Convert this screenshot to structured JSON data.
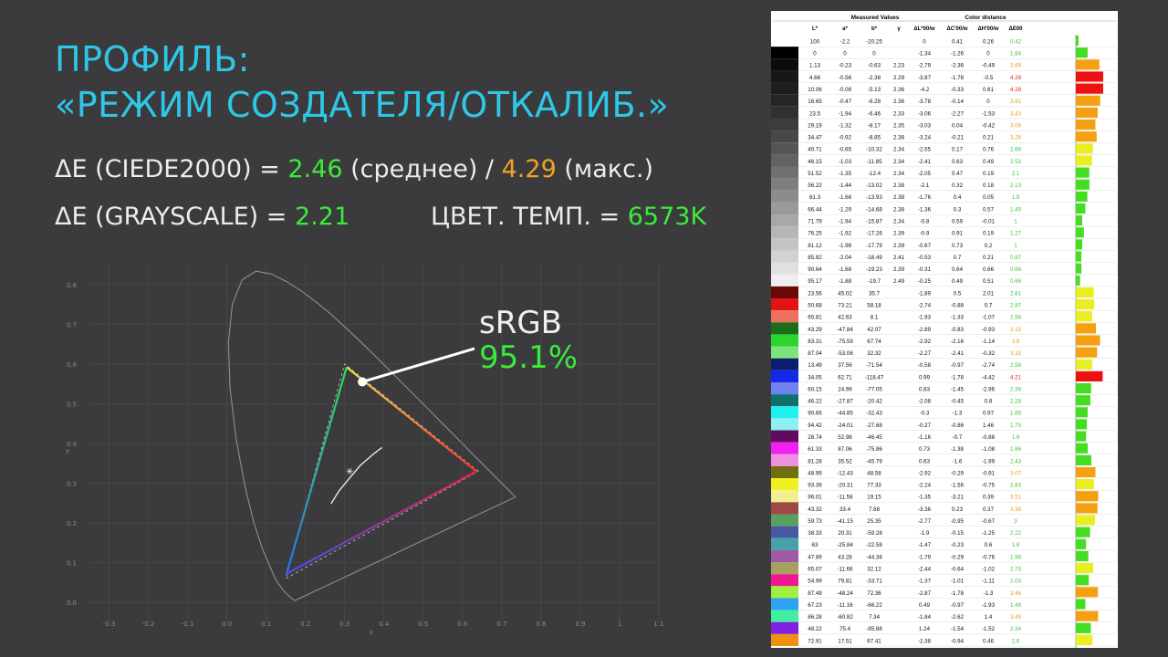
{
  "title": {
    "line1": "ПРОФИЛЬ:",
    "line2": "«РЕЖИМ СОЗДАТЕЛЯ/ОТКАЛИБ.»"
  },
  "stats": {
    "de_prefix": "ΔE (CIEDE2000) =",
    "de_avg": "2.46",
    "avg_label": "(среднее) /",
    "de_max": "4.29",
    "max_label": "(макс.)",
    "gray_prefix": "ΔE (GRAYSCALE) =",
    "gray_value": "2.21",
    "temp_prefix": "ЦВЕТ. ТЕМП. =",
    "temp_value": "6573K"
  },
  "srgb": {
    "name": "sRGB",
    "coverage": "95.1%"
  },
  "colors": {
    "accent_cyan": "#2ec7e8",
    "green": "#3bea3b",
    "orange": "#f2a324",
    "background": "#3b3b3d"
  },
  "chart_data": [
    {
      "type": "scatter",
      "title": "",
      "xlabel": "x",
      "ylabel": "y",
      "xlim": [
        -0.35,
        1.1
      ],
      "ylim": [
        -0.05,
        0.85
      ],
      "x_ticks": [
        "-0.3",
        "-0.2",
        "-0.1",
        "0.0",
        "0.1",
        "0.2",
        "0.3",
        "0.4",
        "0.5",
        "0.6",
        "0.7",
        "0.8",
        "0.9",
        "1",
        "1.1"
      ],
      "y_ticks": [
        "0.0",
        "0.1",
        "0.2",
        "0.3",
        "0.4",
        "0.5",
        "0.6",
        "0.7",
        "0.8"
      ],
      "grid": true,
      "primaries": {
        "red": [
          0.64,
          0.33
        ],
        "green": [
          0.3,
          0.6
        ],
        "blue": [
          0.15,
          0.06
        ],
        "white": [
          0.3127,
          0.329
        ]
      },
      "coverage_marker": [
        0.345,
        0.555
      ]
    },
    {
      "type": "table",
      "header_group_1": "Measured Values",
      "header_group_2": "Color distance",
      "columns": [
        "L*",
        "a*",
        "b*",
        "γ",
        "ΔL*00/w",
        "ΔC'00/w",
        "ΔH'00/w",
        "ΔE00"
      ],
      "rows": [
        {
          "swatch": "#ffffff",
          "v": [
            "100",
            "-2.2",
            "-20.25",
            "",
            "0",
            "0.41",
            "0.26",
            "0.42"
          ],
          "de": 0.42
        },
        {
          "swatch": "#000000",
          "v": [
            "0",
            "0",
            "0",
            "",
            "-1.34",
            "-1.26",
            "0",
            "1.84"
          ],
          "de": 1.84
        },
        {
          "swatch": "#0c0c0c",
          "v": [
            "1.13",
            "-0.23",
            "-0.63",
            "2.23",
            "-2.79",
            "-2.36",
            "-0.49",
            "3.69"
          ],
          "de": 3.69
        },
        {
          "swatch": "#171717",
          "v": [
            "4.66",
            "-0.56",
            "-2.38",
            "2.29",
            "-3.87",
            "-1.78",
            "-0.5",
            "4.29"
          ],
          "de": 4.29
        },
        {
          "swatch": "#1e1e1e",
          "v": [
            "10.06",
            "-0.08",
            "-5.13",
            "2.36",
            "-4.2",
            "-0.33",
            "0.61",
            "4.28"
          ],
          "de": 4.28
        },
        {
          "swatch": "#262626",
          "v": [
            "16.65",
            "-0.47",
            "-6.28",
            "2.36",
            "-3.78",
            "-0.14",
            "0",
            "3.81"
          ],
          "de": 3.81
        },
        {
          "swatch": "#303030",
          "v": [
            "23.5",
            "-1.94",
            "-6.46",
            "2.33",
            "-3.06",
            "-2.27",
            "-1.53",
            "3.43"
          ],
          "de": 3.43
        },
        {
          "swatch": "#3c3c3c",
          "v": [
            "29.19",
            "-1.32",
            "-8.17",
            "2.35",
            "-3.03",
            "0.04",
            "-0.42",
            "3.06"
          ],
          "de": 3.06
        },
        {
          "swatch": "#484848",
          "v": [
            "34.47",
            "-0.92",
            "-8.85",
            "2.38",
            "-3.24",
            "-0.21",
            "0.21",
            "3.26"
          ],
          "de": 3.26
        },
        {
          "swatch": "#555555",
          "v": [
            "40.71",
            "-0.65",
            "-10.32",
            "2.34",
            "-2.55",
            "0.17",
            "0.76",
            "2.66"
          ],
          "de": 2.66
        },
        {
          "swatch": "#626262",
          "v": [
            "46.15",
            "-1.03",
            "-11.85",
            "2.34",
            "-2.41",
            "0.63",
            "0.49",
            "2.53"
          ],
          "de": 2.53
        },
        {
          "swatch": "#707070",
          "v": [
            "51.52",
            "-1.35",
            "-12.4",
            "2.34",
            "-2.05",
            "0.47",
            "0.19",
            "2.1"
          ],
          "de": 2.1
        },
        {
          "swatch": "#7e7e7e",
          "v": [
            "56.22",
            "-1.44",
            "-13.02",
            "2.38",
            "-2.1",
            "0.32",
            "0.18",
            "2.13"
          ],
          "de": 2.13
        },
        {
          "swatch": "#8c8c8c",
          "v": [
            "61.3",
            "-1.66",
            "-13.93",
            "2.38",
            "-1.76",
            "0.4",
            "0.05",
            "1.8"
          ],
          "de": 1.8
        },
        {
          "swatch": "#9a9a9a",
          "v": [
            "66.44",
            "-1.29",
            "-14.68",
            "2.38",
            "-1.36",
            "0.3",
            "0.57",
            "1.49"
          ],
          "de": 1.49
        },
        {
          "swatch": "#a8a8a8",
          "v": [
            "71.79",
            "-1.94",
            "-15.87",
            "2.34",
            "-0.8",
            "0.59",
            "-0.01",
            "1"
          ],
          "de": 1.0
        },
        {
          "swatch": "#b6b6b6",
          "v": [
            "76.25",
            "-1.92",
            "-17.26",
            "2.39",
            "-0.9",
            "0.91",
            "0.19",
            "1.27"
          ],
          "de": 1.27
        },
        {
          "swatch": "#c4c4c4",
          "v": [
            "81.12",
            "-1.98",
            "-17.79",
            "2.39",
            "-0.67",
            "0.73",
            "0.2",
            "1"
          ],
          "de": 1.0
        },
        {
          "swatch": "#d2d2d2",
          "v": [
            "85.82",
            "-2.04",
            "-18.49",
            "2.41",
            "-0.53",
            "0.7",
            "0.21",
            "0.87"
          ],
          "de": 0.87
        },
        {
          "swatch": "#e0e0e0",
          "v": [
            "90.64",
            "-1.68",
            "-19.23",
            "2.39",
            "-0.31",
            "0.64",
            "0.66",
            "0.88"
          ],
          "de": 0.88
        },
        {
          "swatch": "#efefef",
          "v": [
            "95.17",
            "-1.88",
            "-19.7",
            "2.49",
            "-0.25",
            "0.49",
            "0.51",
            "0.66"
          ],
          "de": 0.66
        },
        {
          "swatch": "#6b0808",
          "v": [
            "23.56",
            "45.02",
            "35.7",
            "",
            "-1.89",
            "0.5",
            "2.01",
            "2.81"
          ],
          "de": 2.81
        },
        {
          "swatch": "#e01414",
          "v": [
            "50.68",
            "73.21",
            "58.18",
            "",
            "-2.74",
            "-0.88",
            "0.7",
            "2.87"
          ],
          "de": 2.87
        },
        {
          "swatch": "#f07060",
          "v": [
            "65.81",
            "42.63",
            "8.1",
            "",
            "-1.93",
            "-1.33",
            "-1.07",
            "2.56"
          ],
          "de": 2.56
        },
        {
          "swatch": "#1a6e1a",
          "v": [
            "43.29",
            "-47.84",
            "42.07",
            "",
            "-2.89",
            "-0.83",
            "-0.93",
            "3.15"
          ],
          "de": 3.15
        },
        {
          "swatch": "#2cd42c",
          "v": [
            "83.31",
            "-75.59",
            "67.74",
            "",
            "-2.92",
            "-2.16",
            "-1.14",
            "3.8"
          ],
          "de": 3.8
        },
        {
          "swatch": "#7ee47e",
          "v": [
            "87.04",
            "-53.06",
            "32.32",
            "",
            "-2.27",
            "-2.41",
            "-0.32",
            "3.33"
          ],
          "de": 3.33
        },
        {
          "swatch": "#0c1e6e",
          "v": [
            "13.49",
            "37.56",
            "-71.54",
            "",
            "-0.58",
            "-0.97",
            "-2.74",
            "2.58"
          ],
          "de": 2.58
        },
        {
          "swatch": "#1428e8",
          "v": [
            "34.05",
            "62.71",
            "-118.47",
            "",
            "0.99",
            "-1.78",
            "-4.42",
            "4.21"
          ],
          "de": 4.21
        },
        {
          "swatch": "#7080f0",
          "v": [
            "60.15",
            "24.99",
            "-77.05",
            "",
            "0.83",
            "-1.45",
            "-2.96",
            "2.39"
          ],
          "de": 2.39
        },
        {
          "swatch": "#107070",
          "v": [
            "46.22",
            "-27.87",
            "-20.42",
            "",
            "-2.08",
            "-0.45",
            "0.8",
            "2.28"
          ],
          "de": 2.28
        },
        {
          "swatch": "#20f0f0",
          "v": [
            "90.66",
            "-44.85",
            "-32.43",
            "",
            "-0.3",
            "-1.3",
            "0.97",
            "1.85"
          ],
          "de": 1.85
        },
        {
          "swatch": "#90f0f0",
          "v": [
            "94.42",
            "-24.01",
            "-27.68",
            "",
            "-0.27",
            "-0.86",
            "1.46",
            "1.73"
          ],
          "de": 1.73
        },
        {
          "swatch": "#600a60",
          "v": [
            "28.74",
            "52.98",
            "-46.45",
            "",
            "-1.16",
            "-0.7",
            "-0.88",
            "1.6"
          ],
          "de": 1.6
        },
        {
          "swatch": "#f020f0",
          "v": [
            "61.33",
            "87.06",
            "-75.86",
            "",
            "0.73",
            "-1.38",
            "-1.08",
            "1.86"
          ],
          "de": 1.86
        },
        {
          "swatch": "#f090e0",
          "v": [
            "81.28",
            "35.52",
            "-45.79",
            "",
            "0.63",
            "-1.6",
            "-1.99",
            "2.43"
          ],
          "de": 2.43
        },
        {
          "swatch": "#707010",
          "v": [
            "48.99",
            "-12.43",
            "48.58",
            "",
            "-2.92",
            "-0.29",
            "-0.91",
            "3.07"
          ],
          "de": 3.07
        },
        {
          "swatch": "#f0f020",
          "v": [
            "93.39",
            "-20.31",
            "77.33",
            "",
            "-2.24",
            "-1.56",
            "-0.75",
            "2.83"
          ],
          "de": 2.83
        },
        {
          "swatch": "#f0f090",
          "v": [
            "96.01",
            "-11.58",
            "19.15",
            "",
            "-1.35",
            "-3.21",
            "0.39",
            "3.51"
          ],
          "de": 3.51
        },
        {
          "swatch": "#a04848",
          "v": [
            "43.32",
            "33.4",
            "7.68",
            "",
            "-3.36",
            "0.23",
            "0.37",
            "3.39"
          ],
          "de": 3.39
        },
        {
          "swatch": "#58a060",
          "v": [
            "59.73",
            "-41.15",
            "25.35",
            "",
            "-2.77",
            "-0.95",
            "-0.67",
            "3"
          ],
          "de": 3.0
        },
        {
          "swatch": "#4858a0",
          "v": [
            "38.33",
            "20.31",
            "-59.28",
            "",
            "-1.9",
            "-0.15",
            "-1.25",
            "2.22"
          ],
          "de": 2.22
        },
        {
          "swatch": "#48a0a8",
          "v": [
            "63",
            "-25.84",
            "-22.58",
            "",
            "-1.47",
            "-0.23",
            "0.6",
            "1.6"
          ],
          "de": 1.6
        },
        {
          "swatch": "#a058a8",
          "v": [
            "47.89",
            "43.28",
            "-44.38",
            "",
            "-1.79",
            "-0.29",
            "-0.76",
            "1.96"
          ],
          "de": 1.96
        },
        {
          "swatch": "#a8a060",
          "v": [
            "65.07",
            "-11.66",
            "32.12",
            "",
            "-2.44",
            "-0.64",
            "-1.02",
            "2.73"
          ],
          "de": 2.73
        },
        {
          "swatch": "#f01890",
          "v": [
            "54.99",
            "79.81",
            "-33.71",
            "",
            "-1.37",
            "-1.01",
            "-1.11",
            "2.03"
          ],
          "de": 2.03
        },
        {
          "swatch": "#a0f040",
          "v": [
            "87.49",
            "-48.24",
            "72.36",
            "",
            "-2.87",
            "-1.78",
            "-1.3",
            "3.46"
          ],
          "de": 3.46
        },
        {
          "swatch": "#30a0f0",
          "v": [
            "67.23",
            "-11.16",
            "-66.22",
            "",
            "0.49",
            "-0.97",
            "-1.93",
            "1.49"
          ],
          "de": 1.49
        },
        {
          "swatch": "#40f0a0",
          "v": [
            "86.28",
            "-60.82",
            "7.34",
            "",
            "-1.84",
            "-2.62",
            "1.4",
            "3.49"
          ],
          "de": 3.49
        },
        {
          "swatch": "#8020e0",
          "v": [
            "48.22",
            "75.4",
            "-95.88",
            "",
            "1.24",
            "-1.54",
            "-1.52",
            "2.34"
          ],
          "de": 2.34
        },
        {
          "swatch": "#f09010",
          "v": [
            "72.91",
            "17.51",
            "67.41",
            "",
            "-2.38",
            "-0.94",
            "0.46",
            "2.6"
          ],
          "de": 2.6
        }
      ]
    }
  ]
}
